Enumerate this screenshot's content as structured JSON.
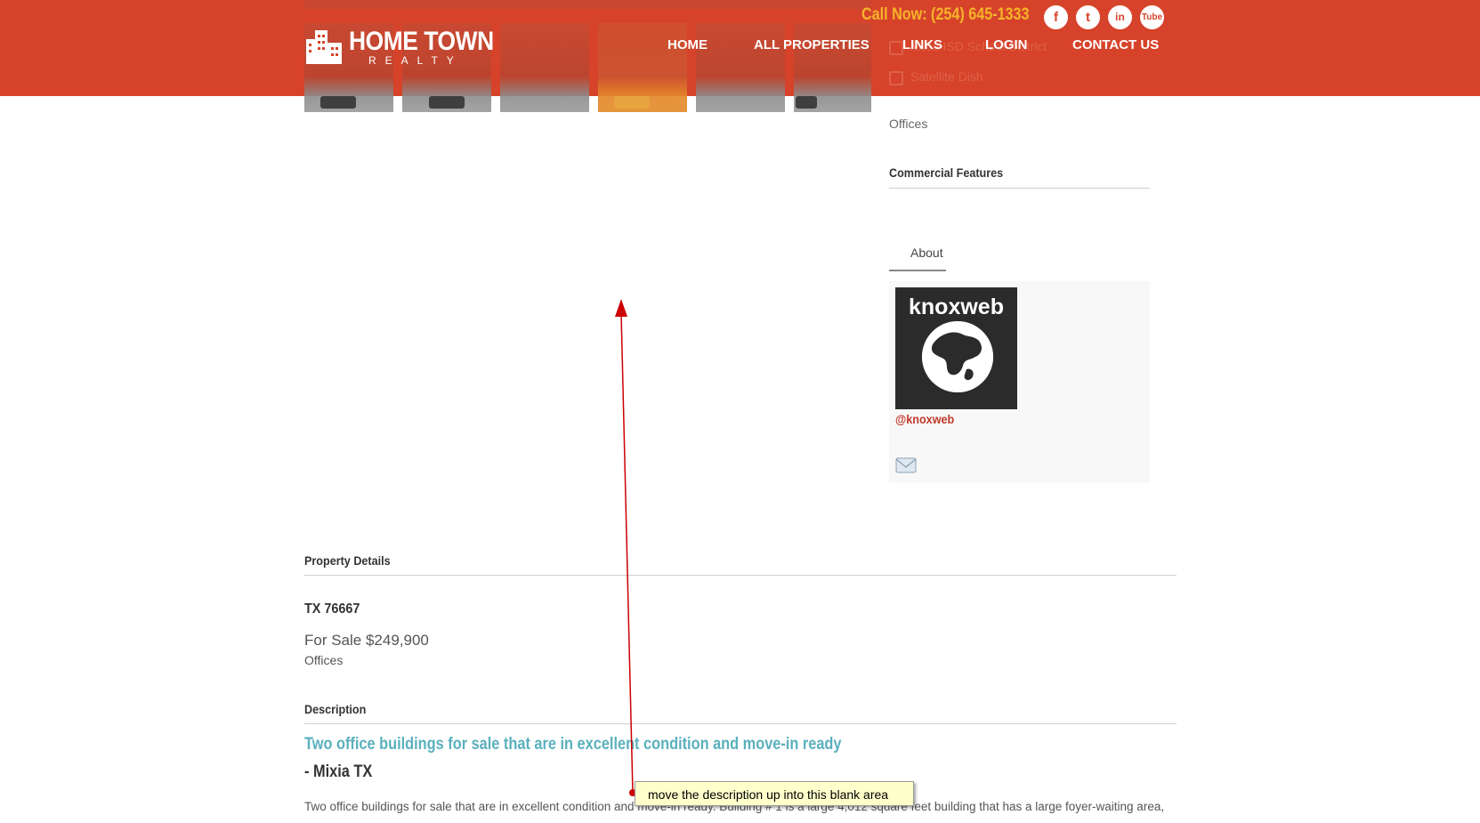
{
  "header": {
    "brand": {
      "title": "HOME TOWN",
      "subtitle": "REALTY"
    },
    "call_now": "Call Now: (254) 645-1333",
    "social": [
      {
        "name": "facebook",
        "glyph": "f"
      },
      {
        "name": "twitter",
        "glyph": "t"
      },
      {
        "name": "linkedin",
        "glyph": "in"
      },
      {
        "name": "youtube",
        "glyph": "Tube"
      }
    ],
    "nav": [
      "HOME",
      "ALL PROPERTIES",
      "LINKS",
      "LOGIN",
      "CONTACT US"
    ],
    "accent_color": "#d6432a"
  },
  "sidebar": {
    "features_faded": [
      "Mixia ISD School District",
      "Satellite Dish"
    ],
    "property_type": "Offices",
    "commercial_heading": "Commercial Features",
    "about_tab": "About",
    "profile": {
      "brand": "knoxweb",
      "handle": "@knoxweb"
    }
  },
  "main": {
    "details_title": "Property Details",
    "zip": "TX 76667",
    "price": "For Sale $249,900",
    "type": "Offices",
    "description_title": "Description",
    "headline": "Two office buildings for sale that are in excellent condition and move-in ready",
    "location": "- Mixia TX",
    "description_text": "Two office buildings for sale that are in excellent condition and move-in ready. Building # 1 is a large 4,012 square feet building that has a large foyer-waiting area,"
  },
  "annotation": {
    "note": "move the description up into this blank area",
    "arrow_color": "#cc0000"
  }
}
